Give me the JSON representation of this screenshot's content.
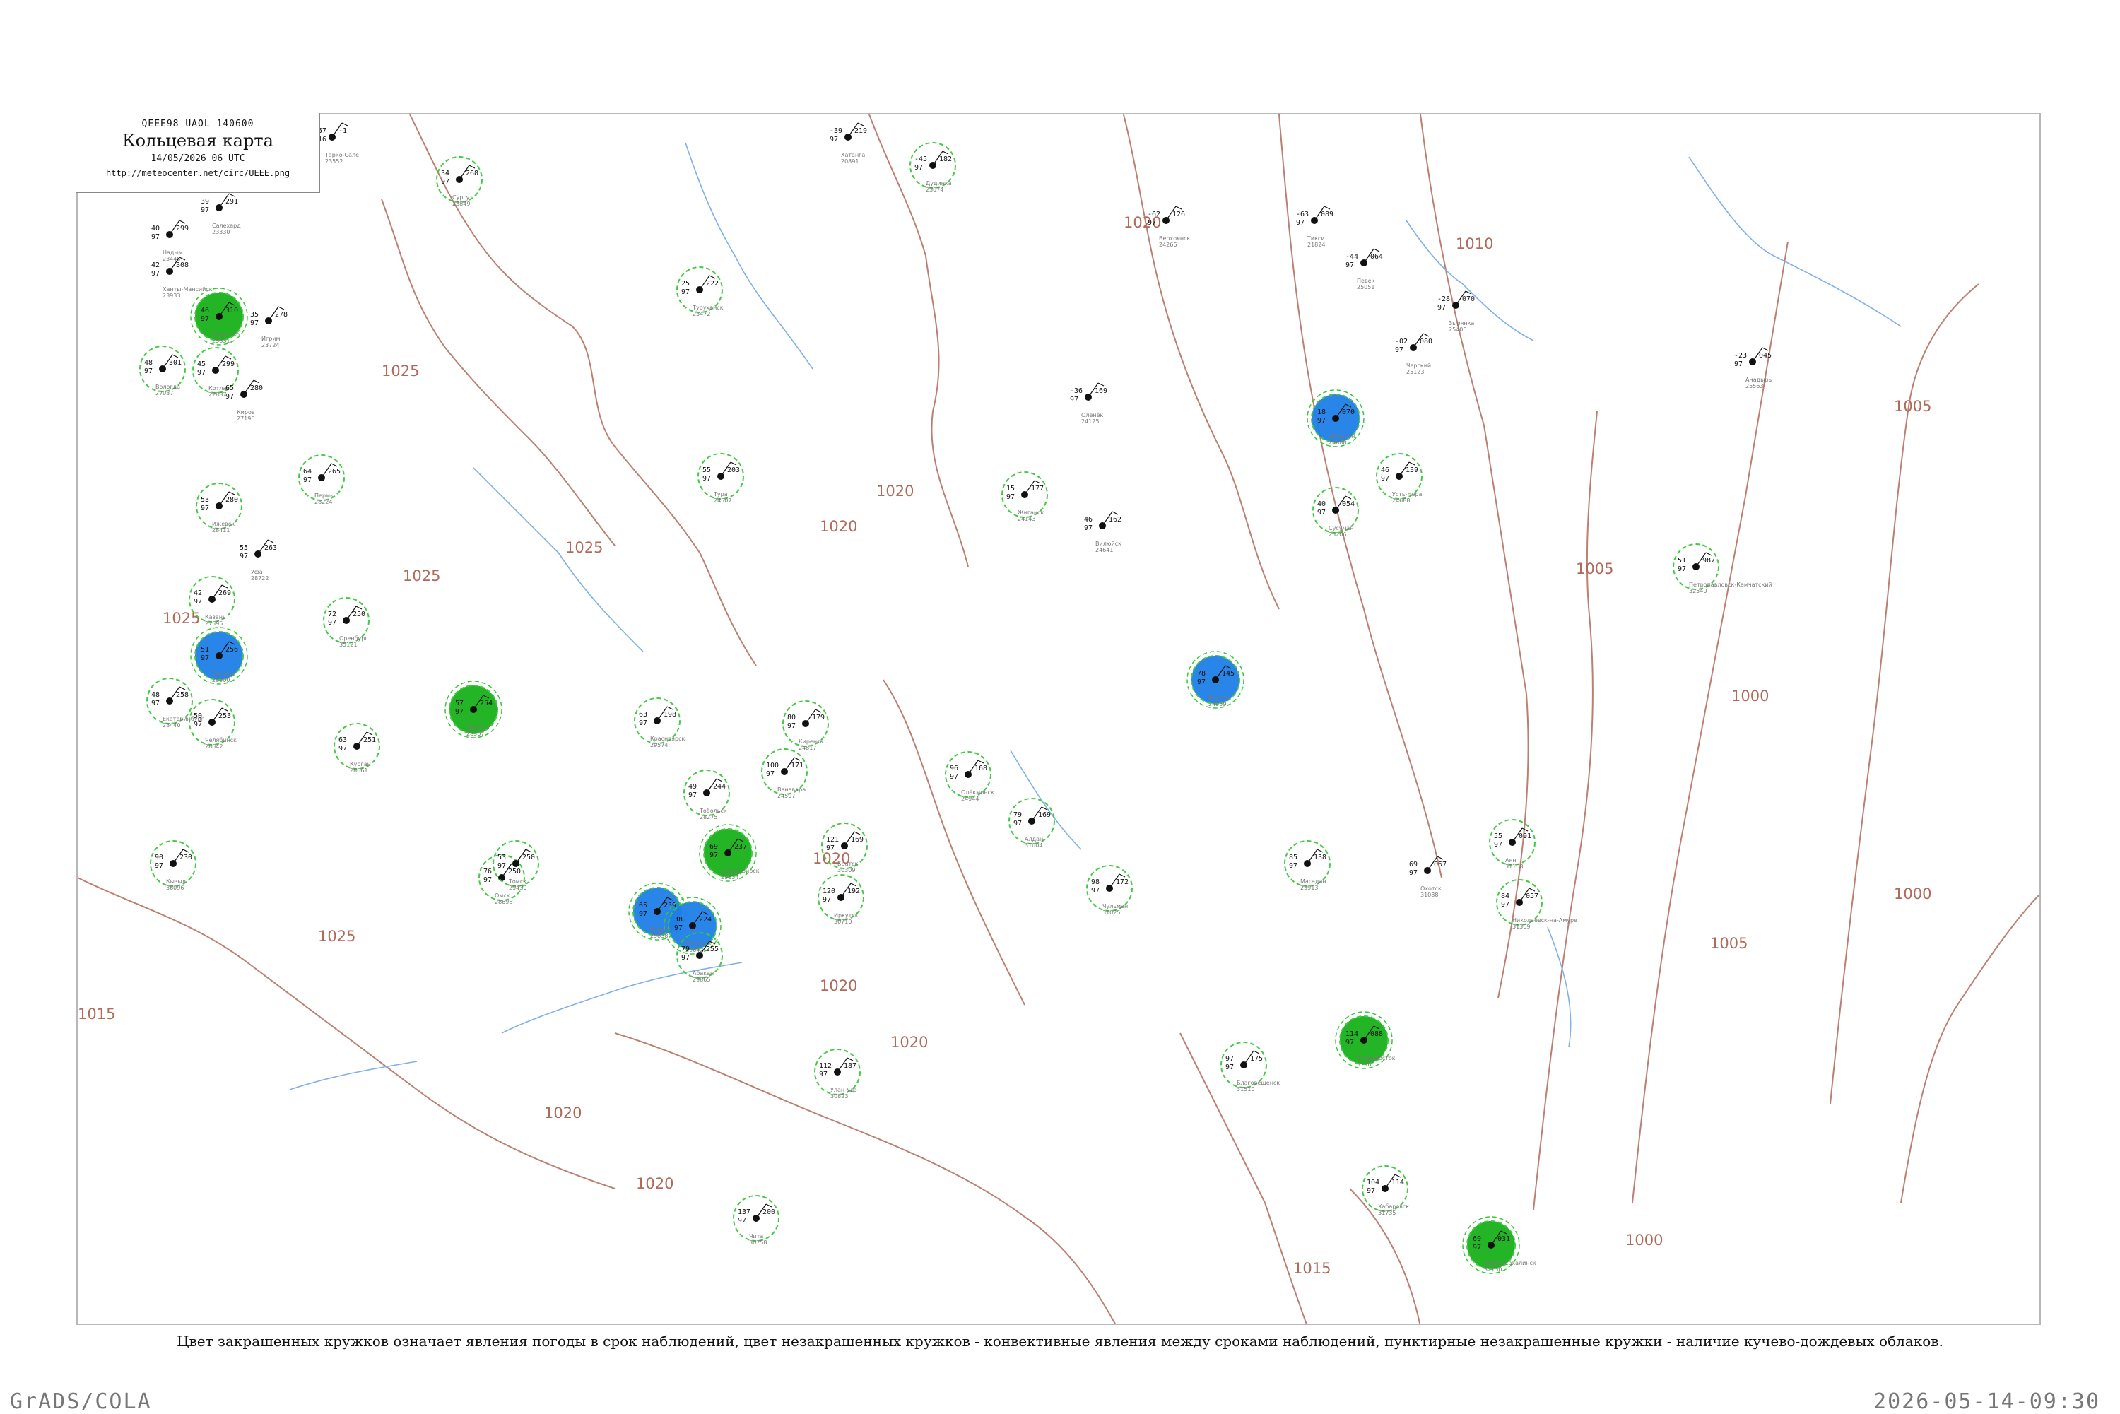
{
  "header": {
    "code": "QEEE98  UAOL  140600",
    "title": "Кольцевая карта",
    "datetime": "14/05/2026 06 UTC",
    "url": "http://meteocenter.net/circ/UEEE.png"
  },
  "caption": "Цвет закрашенных кружков означает явления погоды в срок наблюдений, цвет незакрашенных кружков - конвективные явления между сроками наблюдений, пунктирные незакрашенные кружки - наличие кучево-дождевых облаков.",
  "footer": {
    "left": "GrADS/COLA",
    "right": "2026-05-14-09:30"
  },
  "colors": {
    "shower": "#1f7fe8",
    "thunder": "#19b21b",
    "fog": "#3fe0c8",
    "dust": "#b8b48a",
    "cb_dashed": "#39c739",
    "isobar": "#b06a5a",
    "river": "#7fb0e8",
    "frame": "#b8b8b8"
  },
  "isobars": [
    "1025",
    "1025",
    "1025",
    "1025",
    "1025",
    "1020",
    "1020",
    "1020",
    "1020",
    "1020",
    "1020",
    "1020",
    "1020",
    "1015",
    "1015",
    "1010",
    "1005",
    "1005",
    "1005",
    "1000",
    "1000",
    "1000"
  ],
  "stations": [
    {
      "name": "Тарко-Сале",
      "id": "23552",
      "vals": [
        "257",
        "-16",
        "-1"
      ],
      "kind": "plain"
    },
    {
      "name": "Сургут",
      "id": "23849",
      "vals": [
        "34",
        "97",
        "268"
      ],
      "kind": "dashed"
    },
    {
      "name": "Салехард",
      "id": "23330",
      "vals": [
        "39",
        "97",
        "291"
      ],
      "kind": "plain"
    },
    {
      "name": "Надым",
      "id": "23445",
      "vals": [
        "40",
        "97",
        "299"
      ],
      "kind": "plain"
    },
    {
      "name": "Ханты-Мансийск",
      "id": "23933",
      "vals": [
        "42",
        "97",
        "308"
      ],
      "kind": "plain"
    },
    {
      "name": "Березово",
      "id": "23631",
      "vals": [
        "46",
        "97",
        "310"
      ],
      "kind": "thunder"
    },
    {
      "name": "Игрим",
      "id": "23724",
      "vals": [
        "35",
        "97",
        "278"
      ],
      "kind": "plain"
    },
    {
      "name": "Вологда",
      "id": "27037",
      "vals": [
        "48",
        "97",
        "301"
      ],
      "kind": "dashed"
    },
    {
      "name": "Котлас",
      "id": "22887",
      "vals": [
        "45",
        "97",
        "299"
      ],
      "kind": "dashed"
    },
    {
      "name": "Киров",
      "id": "27196",
      "vals": [
        "65",
        "97",
        "280"
      ],
      "kind": "plain"
    },
    {
      "name": "Пермь",
      "id": "28224",
      "vals": [
        "64",
        "97",
        "265"
      ],
      "kind": "dashed"
    },
    {
      "name": "Ижевск",
      "id": "28411",
      "vals": [
        "53",
        "97",
        "280"
      ],
      "kind": "dashed"
    },
    {
      "name": "Уфа",
      "id": "28722",
      "vals": [
        "55",
        "97",
        "263"
      ],
      "kind": "plain"
    },
    {
      "name": "Казань",
      "id": "27595",
      "vals": [
        "42",
        "97",
        "269"
      ],
      "kind": "dashed"
    },
    {
      "name": "Самара",
      "id": "28900",
      "vals": [
        "51",
        "97",
        "256"
      ],
      "kind": "shower"
    },
    {
      "name": "Оренбург",
      "id": "35121",
      "vals": [
        "72",
        "97",
        "250"
      ],
      "kind": "dashed"
    },
    {
      "name": "Екатеринбург",
      "id": "28440",
      "vals": [
        "48",
        "97",
        "258"
      ],
      "kind": "dashed"
    },
    {
      "name": "Челябинск",
      "id": "28642",
      "vals": [
        "50",
        "97",
        "253"
      ],
      "kind": "dashed"
    },
    {
      "name": "Курган",
      "id": "28661",
      "vals": [
        "63",
        "97",
        "251"
      ],
      "kind": "dashed"
    },
    {
      "name": "Тюмень",
      "id": "28367",
      "vals": [
        "57",
        "97",
        "254"
      ],
      "kind": "thunder"
    },
    {
      "name": "Тобольск",
      "id": "28275",
      "vals": [
        "49",
        "97",
        "244"
      ],
      "kind": "dashed"
    },
    {
      "name": "Омск",
      "id": "28698",
      "vals": [
        "76",
        "97",
        "250"
      ],
      "kind": "dashed"
    },
    {
      "name": "Новосибирск",
      "id": "29634",
      "vals": [
        "69",
        "97",
        "237"
      ],
      "kind": "thunder"
    },
    {
      "name": "Томск",
      "id": "29430",
      "vals": [
        "53",
        "97",
        "250"
      ],
      "kind": "dashed"
    },
    {
      "name": "Барнаул",
      "id": "29838",
      "vals": [
        "65",
        "97",
        "239"
      ],
      "kind": "shower"
    },
    {
      "name": "Кемерово",
      "id": "29642",
      "vals": [
        "38",
        "97",
        "224"
      ],
      "kind": "shower"
    },
    {
      "name": "Красноярск",
      "id": "29574",
      "vals": [
        "63",
        "97",
        "198"
      ],
      "kind": "dashed"
    },
    {
      "name": "Абакан",
      "id": "29865",
      "vals": [
        "79",
        "97",
        "255"
      ],
      "kind": "dashed"
    },
    {
      "name": "Кызыл",
      "id": "36096",
      "vals": [
        "90",
        "97",
        "230"
      ],
      "kind": "dashed"
    },
    {
      "name": "Иркутск",
      "id": "30710",
      "vals": [
        "120",
        "97",
        "192"
      ],
      "kind": "dashed"
    },
    {
      "name": "Улан-Удэ",
      "id": "30823",
      "vals": [
        "112",
        "97",
        "187"
      ],
      "kind": "dashed"
    },
    {
      "name": "Чита",
      "id": "30758",
      "vals": [
        "137",
        "97",
        "200"
      ],
      "kind": "dashed"
    },
    {
      "name": "Братск",
      "id": "30309",
      "vals": [
        "121",
        "97",
        "169"
      ],
      "kind": "dashed"
    },
    {
      "name": "Киренск",
      "id": "24817",
      "vals": [
        "80",
        "97",
        "179"
      ],
      "kind": "dashed"
    },
    {
      "name": "Ванавара",
      "id": "24507",
      "vals": [
        "100",
        "97",
        "171"
      ],
      "kind": "dashed"
    },
    {
      "name": "Туруханск",
      "id": "23472",
      "vals": [
        "25",
        "97",
        "222"
      ],
      "kind": "dashed"
    },
    {
      "name": "Тура",
      "id": "24507",
      "vals": [
        "55",
        "97",
        "203"
      ],
      "kind": "dashed"
    },
    {
      "name": "Хатанга",
      "id": "20891",
      "vals": [
        "-39",
        "97",
        "219"
      ],
      "kind": "plain"
    },
    {
      "name": "Дудинка",
      "id": "23074",
      "vals": [
        "-45",
        "97",
        "182"
      ],
      "kind": "dashed"
    },
    {
      "name": "Оленёк",
      "id": "24125",
      "vals": [
        "-36",
        "97",
        "169"
      ],
      "kind": "plain"
    },
    {
      "name": "Жиганск",
      "id": "24143",
      "vals": [
        "15",
        "97",
        "177"
      ],
      "kind": "dashed"
    },
    {
      "name": "Вилюйск",
      "id": "24641",
      "vals": [
        "46",
        "97",
        "162"
      ],
      "kind": "plain"
    },
    {
      "name": "Якутск",
      "id": "24959",
      "vals": [
        "78",
        "97",
        "145"
      ],
      "kind": "shower"
    },
    {
      "name": "Олёкминск",
      "id": "24944",
      "vals": [
        "96",
        "97",
        "168"
      ],
      "kind": "dashed"
    },
    {
      "name": "Алдан",
      "id": "31004",
      "vals": [
        "79",
        "97",
        "169"
      ],
      "kind": "dashed"
    },
    {
      "name": "Чульман",
      "id": "31025",
      "vals": [
        "98",
        "97",
        "172"
      ],
      "kind": "dashed"
    },
    {
      "name": "Верхоянск",
      "id": "24266",
      "vals": [
        "-62",
        "97",
        "126"
      ],
      "kind": "plain"
    },
    {
      "name": "Усть-Нера",
      "id": "24688",
      "vals": [
        "46",
        "97",
        "139"
      ],
      "kind": "dashed"
    },
    {
      "name": "Оймякон",
      "id": "24688",
      "vals": [
        "18",
        "97",
        "070"
      ],
      "kind": "shower"
    },
    {
      "name": "Сусуман",
      "id": "25206",
      "vals": [
        "40",
        "97",
        "054"
      ],
      "kind": "dashed"
    },
    {
      "name": "Магадан",
      "id": "25913",
      "vals": [
        "85",
        "97",
        "138"
      ],
      "kind": "dashed"
    },
    {
      "name": "Охотск",
      "id": "31088",
      "vals": [
        "69",
        "97",
        "067"
      ],
      "kind": "plain"
    },
    {
      "name": "Аян",
      "id": "31168",
      "vals": [
        "55",
        "97",
        "091"
      ],
      "kind": "dashed"
    },
    {
      "name": "Николаевск-на-Амуре",
      "id": "31369",
      "vals": [
        "84",
        "97",
        "057"
      ],
      "kind": "dashed"
    },
    {
      "name": "Хабаровск",
      "id": "31735",
      "vals": [
        "104",
        "97",
        "114"
      ],
      "kind": "dashed"
    },
    {
      "name": "Благовещенск",
      "id": "31510",
      "vals": [
        "97",
        "97",
        "175"
      ],
      "kind": "dashed"
    },
    {
      "name": "Владивосток",
      "id": "31960",
      "vals": [
        "114",
        "97",
        "088"
      ],
      "kind": "thunder"
    },
    {
      "name": "Южно-Сахалинск",
      "id": "32150",
      "vals": [
        "69",
        "97",
        "031"
      ],
      "kind": "thunder"
    },
    {
      "name": "Петропавловск-Камчатский",
      "id": "32540",
      "vals": [
        "51",
        "97",
        "987"
      ],
      "kind": "dashed"
    },
    {
      "name": "Анадырь",
      "id": "25563",
      "vals": [
        "-23",
        "97",
        "045"
      ],
      "kind": "plain"
    },
    {
      "name": "Певек",
      "id": "25051",
      "vals": [
        "-44",
        "97",
        "064"
      ],
      "kind": "plain"
    },
    {
      "name": "Черский",
      "id": "25123",
      "vals": [
        "-02",
        "97",
        "080"
      ],
      "kind": "plain"
    },
    {
      "name": "Зырянка",
      "id": "25400",
      "vals": [
        "-28",
        "97",
        "070"
      ],
      "kind": "plain"
    },
    {
      "name": "Тикси",
      "id": "21824",
      "vals": [
        "-63",
        "97",
        "089"
      ],
      "kind": "plain"
    }
  ]
}
